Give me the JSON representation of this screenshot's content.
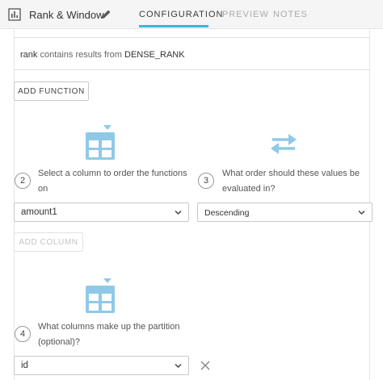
{
  "header": {
    "recipe_name": "Rank & Window",
    "tabs": [
      {
        "label": "CONFIGURATION"
      },
      {
        "label": "PREVIEW"
      },
      {
        "label": "NOTES"
      }
    ]
  },
  "info": {
    "variable": "rank",
    "text_middle": " contains results from ",
    "function_name": "DENSE_RANK"
  },
  "add_function_label": "ADD FUNCTION",
  "order_section": {
    "step_number": "2",
    "label": "Select a column to order the functions on",
    "selected_column": "amount1",
    "add_column_label": "ADD COLUMN"
  },
  "direction_section": {
    "step_number": "3",
    "label": "What order should these values be evaluated in?",
    "selected_order": "Descending"
  },
  "partition_section": {
    "step_number": "4",
    "label": "What columns make up the partition (optional)?",
    "selected_column": "id"
  },
  "colors": {
    "accent": "#3bb5d6",
    "icon_blue": "#8fc9e8"
  },
  "icons": [
    "chart-icon",
    "pencil-icon",
    "table-icon",
    "swap-arrows-icon",
    "chevron-down-icon",
    "close-icon"
  ]
}
